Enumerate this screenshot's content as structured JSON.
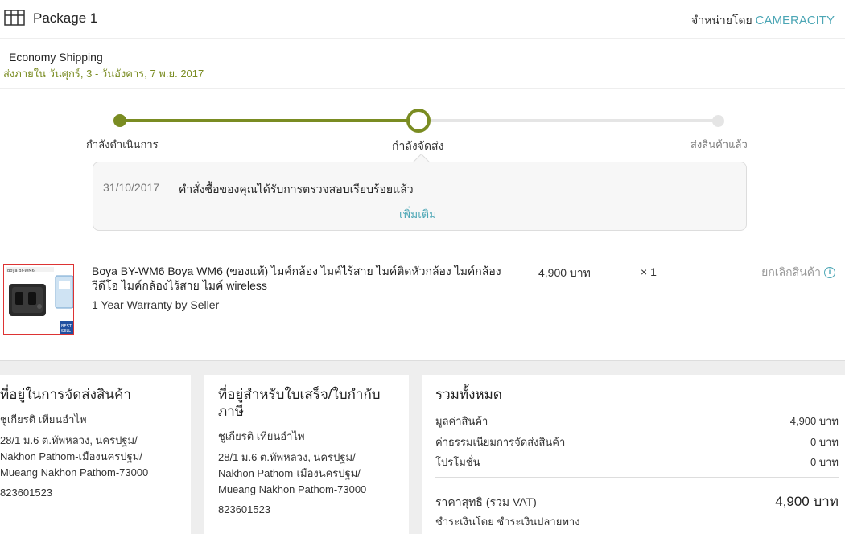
{
  "header": {
    "title": "Package 1",
    "seller_prefix": "จำหน่ายโดย",
    "seller_name": "CAMERACITY"
  },
  "shipping": {
    "method": "Economy Shipping",
    "eta": "ส่งภายใน วันศุกร์, 3 - วันอังคาร, 7 พ.ย. 2017"
  },
  "progress": {
    "steps": [
      {
        "label": "กำลังดำเนินการ",
        "state": "done"
      },
      {
        "label": "กำลังจัดส่ง",
        "state": "current"
      },
      {
        "label": "ส่งสินค้าแล้ว",
        "state": "pending"
      }
    ]
  },
  "status": {
    "date": "31/10/2017",
    "message": "คำสั่งซื้อของคุณได้รับการตรวจสอบเรียบร้อยแล้ว",
    "more_label": "เพิ่มเติม"
  },
  "item": {
    "name": "Boya BY-WM6 Boya WM6 (ของแท้) ไมค์กล้อง ไมค์ไร้สาย ไมค์ติดหัวกล้อง ไมค์กล้องวีดีโอ ไมค์กล้องไร้สาย ไมค์ wireless",
    "warranty": "1 Year Warranty by Seller",
    "price": "4,900 บาท",
    "quantity": "× 1",
    "cancel_label": "ยกเลิกสินค้า"
  },
  "shipping_address": {
    "title": "ที่อยู่ในการจัดส่งสินค้า",
    "name": "ชูเกียรติ เทียนอำไพ",
    "lines": [
      "28/1 ม.6 ต.ทัพหลวง, นครปฐม/",
      "Nakhon Pathom-เมืองนครปฐม/",
      "Mueang Nakhon Pathom-73000"
    ],
    "phone": "823601523"
  },
  "billing_address": {
    "title": "ที่อยู่สำหรับใบเสร็จ/ใบกำกับภาษี",
    "name": "ชูเกียรติ เทียนอำไพ",
    "lines": [
      "28/1 ม.6 ต.ทัพหลวง, นครปฐม/",
      "Nakhon Pathom-เมืองนครปฐม/",
      "Mueang Nakhon Pathom-73000"
    ],
    "phone": "823601523"
  },
  "summary": {
    "title": "รวมทั้งหมด",
    "rows": [
      {
        "label": "มูลค่าสินค้า",
        "value": "4,900 บาท"
      },
      {
        "label": "ค่าธรรมเนียมการจัดส่งสินค้า",
        "value": "0 บาท"
      },
      {
        "label": "โปรโมชั่น",
        "value": "0 บาท"
      }
    ],
    "total_label": "ราคาสุทธิ (รวม VAT)",
    "total_value": "4,900 บาท",
    "payment": "ชำระเงินโดย ชำระเงินปลายทาง"
  },
  "colors": {
    "accent_green": "#7a8c22",
    "link_teal": "#4ca6b5"
  }
}
